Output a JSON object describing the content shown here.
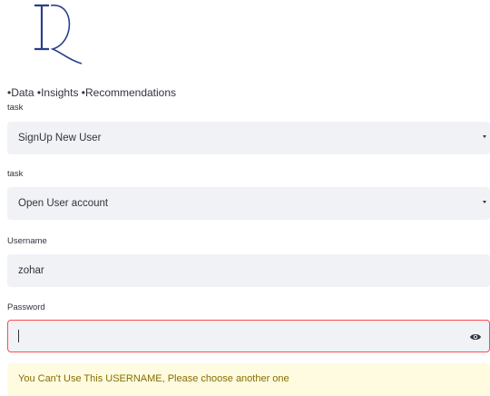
{
  "tagline": "•Data •Insights •Recommendations",
  "form": {
    "task1": {
      "label": "task",
      "value": "SignUp New User"
    },
    "task2": {
      "label": "task",
      "value": "Open User account"
    },
    "username": {
      "label": "Username",
      "value": "zohar"
    },
    "password": {
      "label": "Password",
      "value": ""
    }
  },
  "alert": {
    "text": "You Can't Use This USERNAME, Please choose another one"
  },
  "colors": {
    "error_border": "#ff4b4b",
    "warning_bg": "#fffbe0",
    "warning_text": "#856e00",
    "field_bg": "#f0f2f6"
  },
  "icons": {
    "password_toggle": "eye-icon",
    "select_arrow": "chevron-down-icon"
  }
}
